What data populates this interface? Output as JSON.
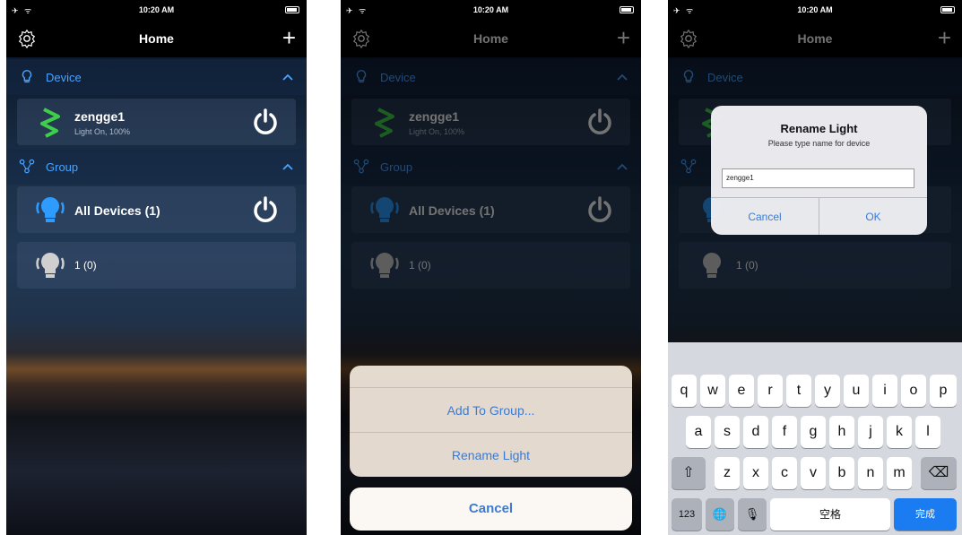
{
  "status": {
    "time": "10:20 AM",
    "signal": "✈ ᯤ"
  },
  "nav": {
    "title": "Home",
    "plus": "+"
  },
  "sections": {
    "device": "Device",
    "group": "Group"
  },
  "device": {
    "name": "zengge1",
    "status": "Light On, 100%"
  },
  "groups": {
    "all": "All Devices (1)",
    "one": "1 (0)"
  },
  "actionsheet": {
    "add": "Add To Group...",
    "rename": "Rename Light",
    "cancel": "Cancel"
  },
  "alert": {
    "title": "Rename Light",
    "message": "Please type name for device",
    "value": "zengge1",
    "cancel": "Cancel",
    "ok": "OK"
  },
  "keyboard": {
    "row1": [
      "q",
      "w",
      "e",
      "r",
      "t",
      "y",
      "u",
      "i",
      "o",
      "p"
    ],
    "row2": [
      "a",
      "s",
      "d",
      "f",
      "g",
      "h",
      "j",
      "k",
      "l"
    ],
    "row3": [
      "z",
      "x",
      "c",
      "v",
      "b",
      "n",
      "m"
    ],
    "numbers": "123",
    "space": "空格",
    "done": "完成",
    "shift": "⇧",
    "globe": "🌐",
    "mic": "🎙",
    "delete": "⌫"
  },
  "colors": {
    "accent": "#4aa3ff",
    "link": "#3a7bd5",
    "done": "#1a7cf0"
  }
}
